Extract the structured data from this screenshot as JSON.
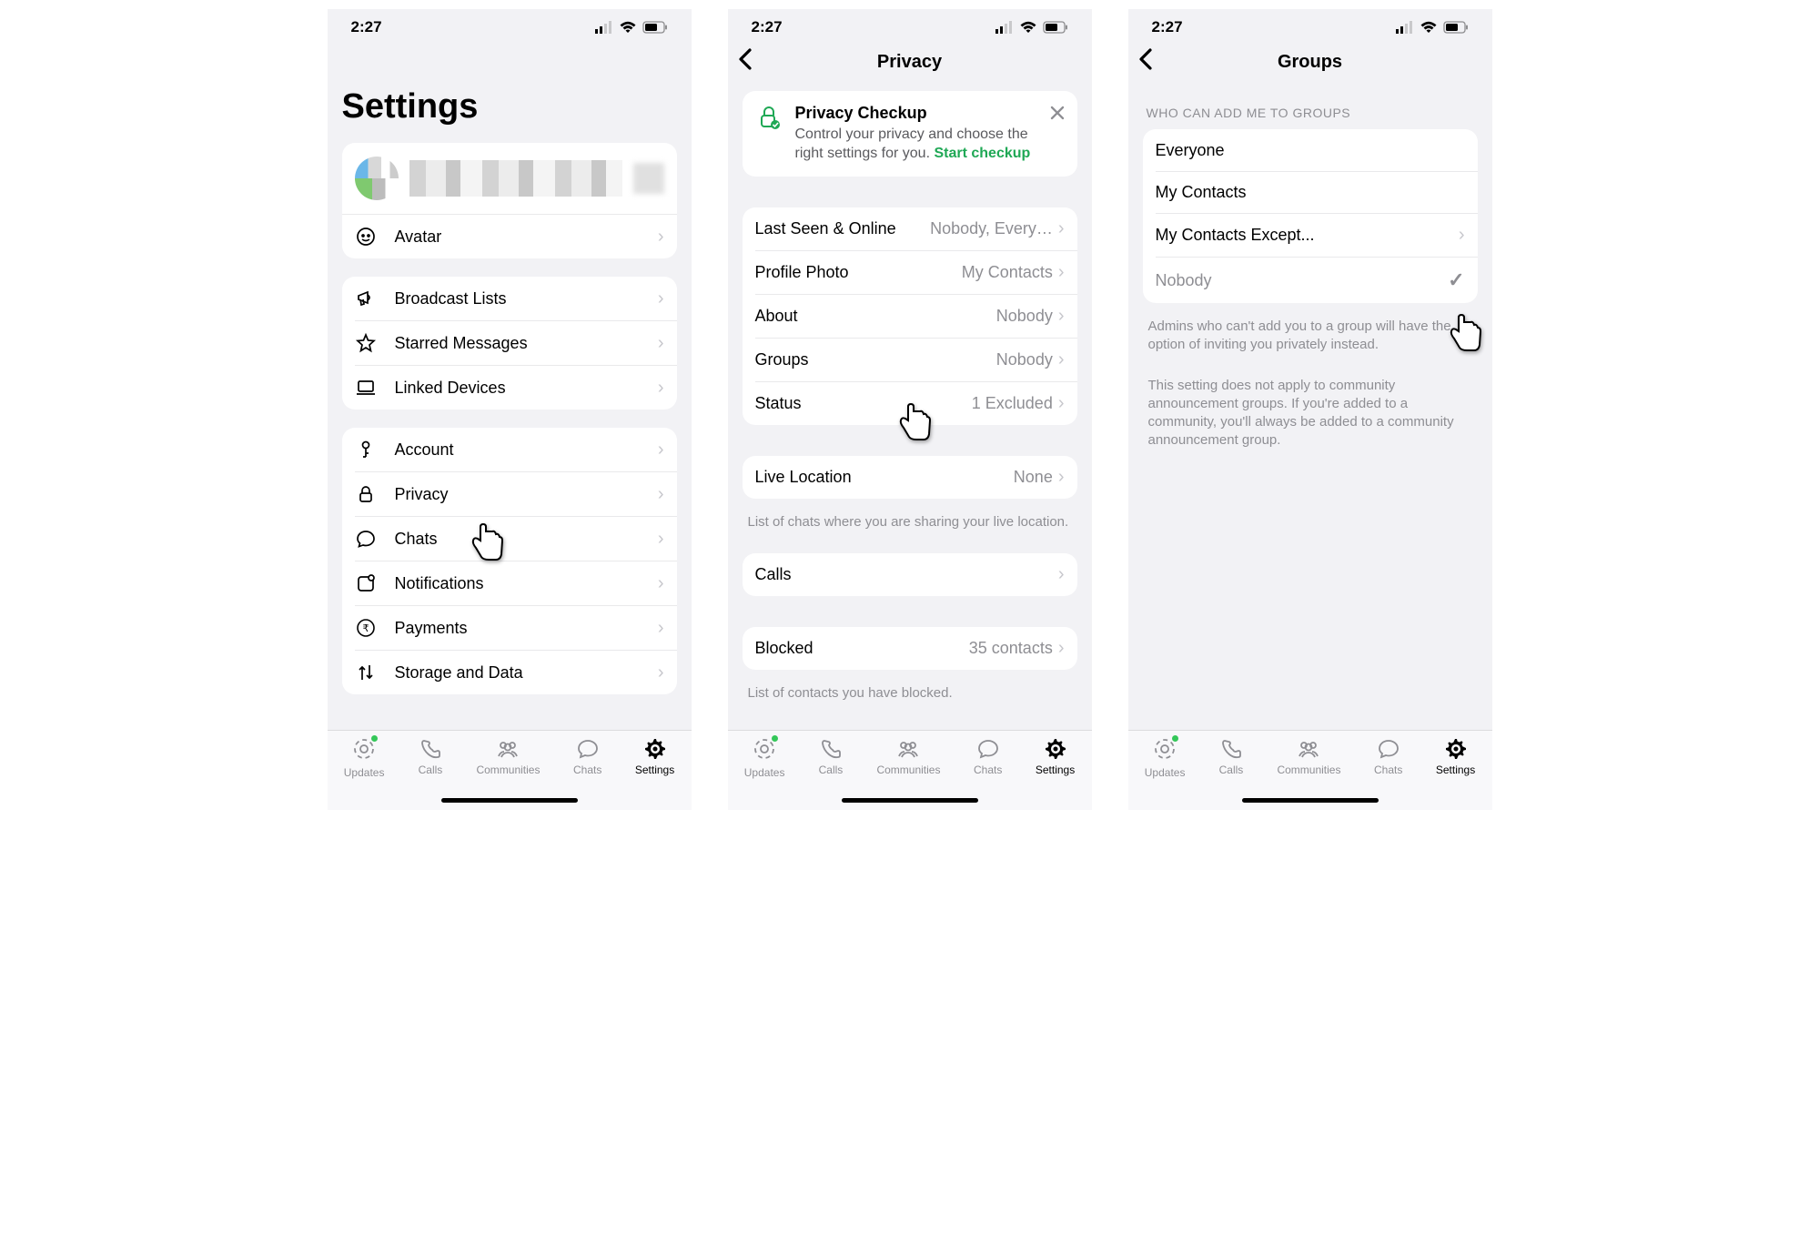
{
  "status": {
    "time": "2:27"
  },
  "tabs": {
    "updates": "Updates",
    "calls": "Calls",
    "communities": "Communities",
    "chats": "Chats",
    "settings": "Settings"
  },
  "screen1": {
    "title": "Settings",
    "avatar": "Avatar",
    "group1": {
      "broadcast": "Broadcast Lists",
      "starred": "Starred Messages",
      "linked": "Linked Devices"
    },
    "group2": {
      "account": "Account",
      "privacy": "Privacy",
      "chats": "Chats",
      "notifications": "Notifications",
      "payments": "Payments",
      "storage": "Storage and Data"
    }
  },
  "screen2": {
    "title": "Privacy",
    "promo": {
      "title": "Privacy Checkup",
      "body": "Control your privacy and choose the right settings for you. ",
      "link": "Start checkup"
    },
    "rows": {
      "lastseen": {
        "label": "Last Seen & Online",
        "value": "Nobody, Every…"
      },
      "photo": {
        "label": "Profile Photo",
        "value": "My Contacts"
      },
      "about": {
        "label": "About",
        "value": "Nobody"
      },
      "groups": {
        "label": "Groups",
        "value": "Nobody"
      },
      "status": {
        "label": "Status",
        "value": "1 Excluded"
      }
    },
    "live": {
      "label": "Live Location",
      "value": "None",
      "note": "List of chats where you are sharing your live location."
    },
    "calls": {
      "label": "Calls"
    },
    "blocked": {
      "label": "Blocked",
      "value": "35 contacts",
      "note": "List of contacts you have blocked."
    }
  },
  "screen3": {
    "title": "Groups",
    "header": "WHO CAN ADD ME TO GROUPS",
    "options": {
      "everyone": "Everyone",
      "contacts": "My Contacts",
      "except": "My Contacts Except...",
      "nobody": "Nobody"
    },
    "note1": "Admins who can't add you to a group will have the option of inviting you privately instead.",
    "note2": "This setting does not apply to community announcement groups. If you're added to a community, you'll always be added to a community announcement group."
  }
}
